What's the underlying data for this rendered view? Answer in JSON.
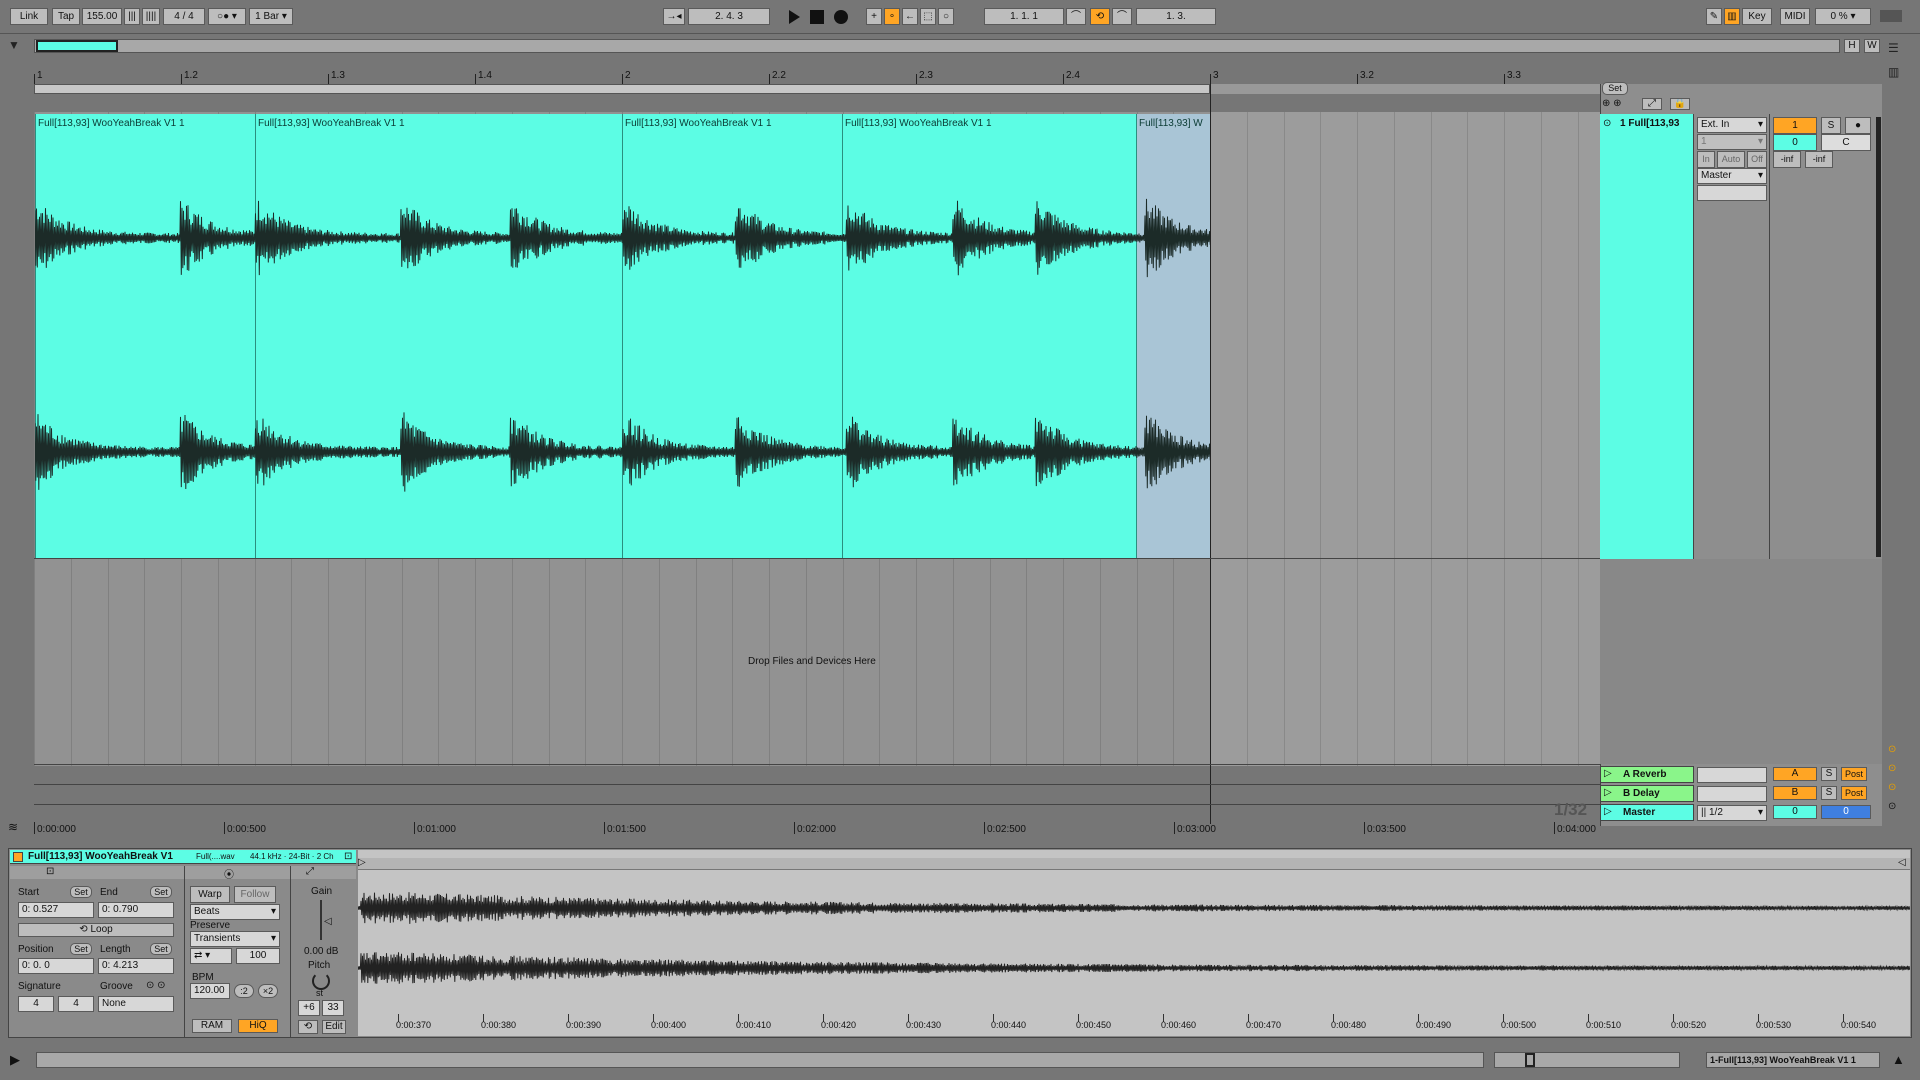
{
  "transport": {
    "link": "Link",
    "tap": "Tap",
    "tempo": "155.00",
    "meter": "4 / 4",
    "quantize": "1 Bar",
    "arrangement_position": "2.   4.   3",
    "loop_start": "1.   1.   1",
    "loop_length": "1.   3.",
    "key": "Key",
    "midi": "MIDI",
    "cpu": "0 %"
  },
  "overview": {
    "h_btn": "H",
    "w_btn": "W"
  },
  "ruler": {
    "beats": [
      "1",
      "1.2",
      "1.3",
      "1.4",
      "2",
      "2.2",
      "2.3",
      "2.4",
      "3",
      "3.2",
      "3.3"
    ],
    "times": [
      "0:00:000",
      "0:00:500",
      "0:01:000",
      "0:01:500",
      "0:02:000",
      "0:02:500",
      "0:03:000",
      "0:03:500",
      "0:04:000"
    ],
    "zoom": "1/32"
  },
  "clips": [
    {
      "name": "Full[113,93] WooYeahBreak V1 1"
    },
    {
      "name": "Full[113,93] WooYeahBreak V1 1"
    },
    {
      "name": "Full[113,93] WooYeahBreak V1 1"
    },
    {
      "name": "Full[113,93] WooYeahBreak V1 1"
    },
    {
      "name": "Full[113,93] W"
    }
  ],
  "drop_text": "Drop Files and Devices Here",
  "mixer": {
    "set_label": "Set",
    "track": {
      "name": "1 Full[113,93",
      "input": "Ext. In",
      "channel": "1",
      "monitor": [
        "In",
        "Auto",
        "Off"
      ],
      "output": "Master",
      "number": "1",
      "solo": "S",
      "vol": "0",
      "pan": "C",
      "meter_l": "-inf",
      "meter_r": "-inf"
    },
    "returns": [
      {
        "name": "A Reverb",
        "letter": "A",
        "solo": "S",
        "post": "Post",
        "color": "#8af58a"
      },
      {
        "name": "B Delay",
        "letter": "B",
        "solo": "S",
        "post": "Post",
        "color": "#8af58a"
      }
    ],
    "master": {
      "name": "Master",
      "cue": "1/2",
      "vol": "0",
      "pan": "0",
      "color": "#5cfde4"
    }
  },
  "clip_view": {
    "title": "Full[113,93] WooYeahBreak V1",
    "file": "Full(....wav",
    "format": "44.1 kHz · 24-Bit · 2 Ch",
    "start_label": "Start",
    "end_label": "End",
    "set": "Set",
    "start": "0:    0.527",
    "end": "0:    0.790",
    "loop": "Loop",
    "position_label": "Position",
    "length_label": "Length",
    "position": "0:    0.    0",
    "length": "0:    4.213",
    "signature_label": "Signature",
    "groove_label": "Groove",
    "sig_num": "4",
    "sig_den": "4",
    "groove": "None",
    "warp": "Warp",
    "follow": "Follow",
    "mode": "Beats",
    "preserve_label": "Preserve",
    "preserve": "Transients",
    "env": "100",
    "bpm_label": "BPM",
    "bpm": "120.00",
    "half": ":2",
    "double": "×2",
    "ram": "RAM",
    "hiq": "HiQ",
    "gain_label": "Gain",
    "gain": "0.00 dB",
    "pitch_label": "Pitch",
    "st": "st",
    "transpose": "+6",
    "detune": "33",
    "edit": "Edit",
    "times": [
      "0:00:370",
      "0:00:380",
      "0:00:390",
      "0:00:400",
      "0:00:410",
      "0:00:420",
      "0:00:430",
      "0:00:440",
      "0:00:450",
      "0:00:460",
      "0:00:470",
      "0:00:480",
      "0:00:490",
      "0:00:500",
      "0:00:510",
      "0:00:520",
      "0:00:530",
      "0:00:540"
    ]
  },
  "status": {
    "selected": "1-Full[113,93] WooYeahBreak V1 1"
  },
  "colors": {
    "clip": "#5cfde4",
    "accent": "#ffa524",
    "bg": "#767676"
  }
}
